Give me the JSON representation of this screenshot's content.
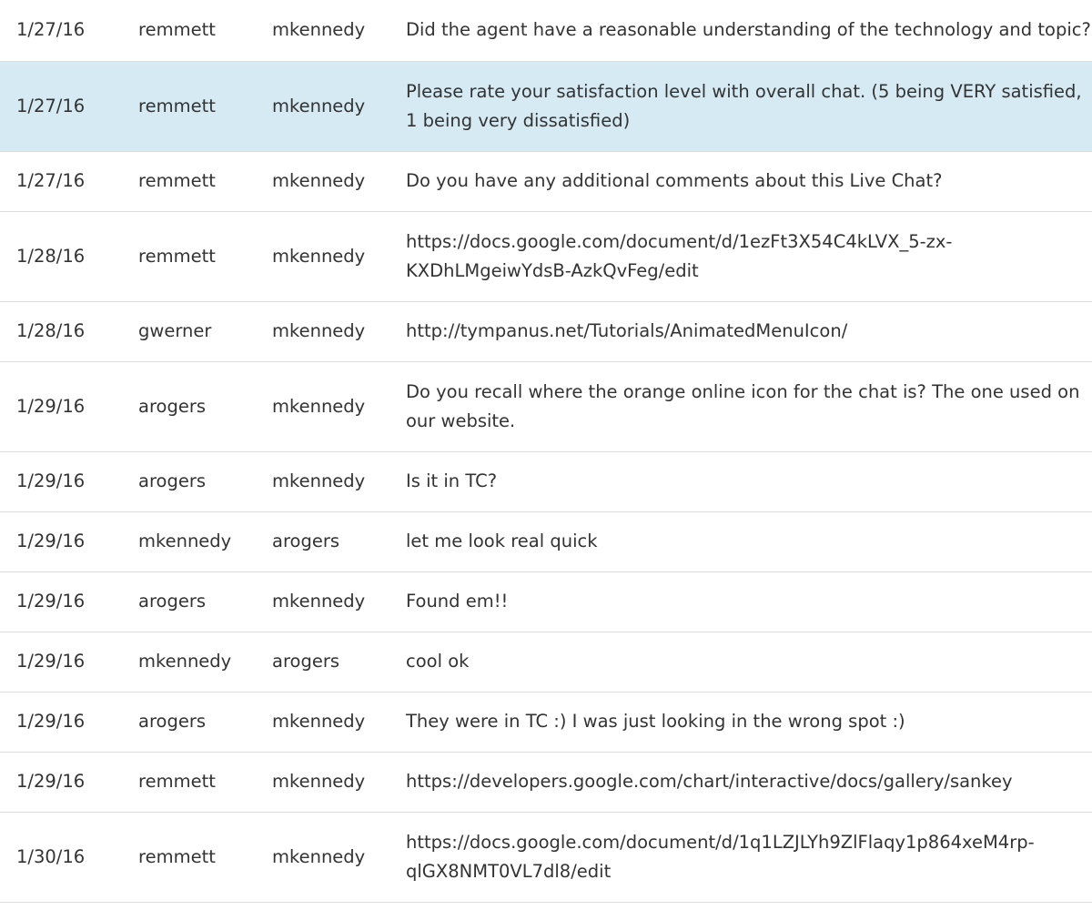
{
  "rows": [
    {
      "date": "1/27/16",
      "from": "remmett",
      "to": "mkennedy",
      "message": "Did the agent have a reasonable understanding of the technology and topic?"
    },
    {
      "date": "1/27/16",
      "from": "remmett",
      "to": "mkennedy",
      "message": "Please rate your satisfaction level with overall chat. (5 being VERY satisfied, 1 being very dissatisfied)"
    },
    {
      "date": "1/27/16",
      "from": "remmett",
      "to": "mkennedy",
      "message": "Do you have any additional comments about this Live Chat?"
    },
    {
      "date": "1/28/16",
      "from": "remmett",
      "to": "mkennedy",
      "message": "https://docs.google.com/document/d/1ezFt3X54C4kLVX_5-zx-KXDhLMgeiwYdsB-AzkQvFeg/edit"
    },
    {
      "date": "1/28/16",
      "from": "gwerner",
      "to": "mkennedy",
      "message": "http://tympanus.net/Tutorials/AnimatedMenuIcon/"
    },
    {
      "date": "1/29/16",
      "from": "arogers",
      "to": "mkennedy",
      "message": "Do you recall where the orange online icon for the chat is? The one used on our website."
    },
    {
      "date": "1/29/16",
      "from": "arogers",
      "to": "mkennedy",
      "message": "Is it in TC?"
    },
    {
      "date": "1/29/16",
      "from": "mkennedy",
      "to": "arogers",
      "message": "let me look real quick"
    },
    {
      "date": "1/29/16",
      "from": "arogers",
      "to": "mkennedy",
      "message": "Found em!!"
    },
    {
      "date": "1/29/16",
      "from": "mkennedy",
      "to": "arogers",
      "message": "cool ok"
    },
    {
      "date": "1/29/16",
      "from": "arogers",
      "to": "mkennedy",
      "message": "They were in TC :) I was just looking in the wrong spot :)"
    },
    {
      "date": "1/29/16",
      "from": "remmett",
      "to": "mkennedy",
      "message": "https://developers.google.com/chart/interactive/docs/gallery/sankey"
    },
    {
      "date": "1/30/16",
      "from": "remmett",
      "to": "mkennedy",
      "message": "https://docs.google.com/document/d/1q1LZJLYh9ZlFlaqy1p864xeM4rp-qlGX8NMT0VL7dl8/edit"
    }
  ],
  "selected_row_index": 1,
  "colors": {
    "selected_row_background": "#d6eaf3",
    "row_divider": "#dddddd",
    "text": "#333333"
  }
}
